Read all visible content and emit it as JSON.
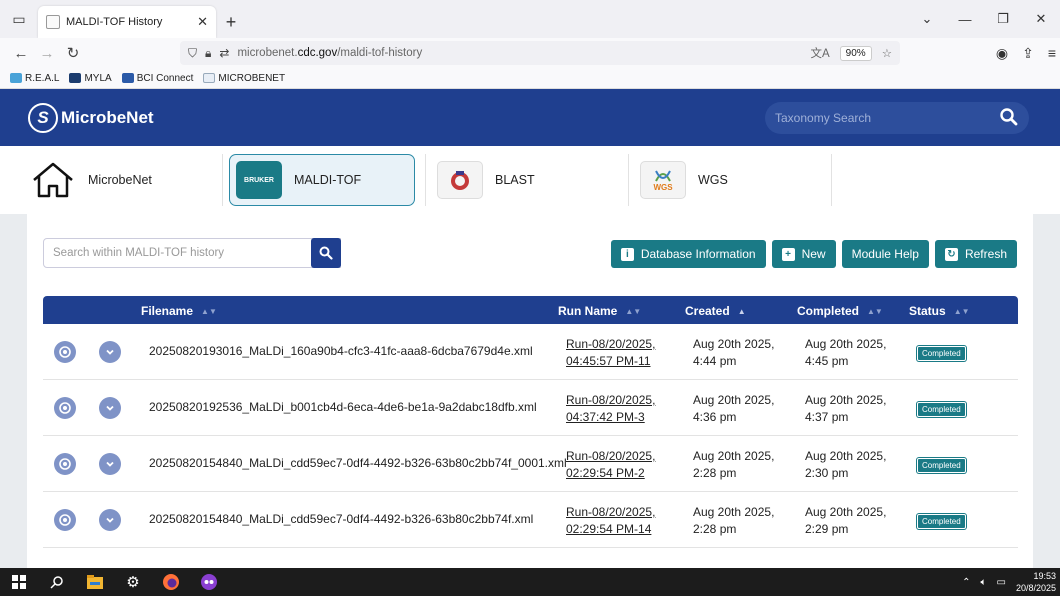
{
  "browser": {
    "tab_title": "MALDI-TOF History",
    "url_prefix": "microbenet.",
    "url_host": "cdc.gov",
    "url_path": "/maldi-tof-history",
    "zoom": "90%",
    "bookmarks": [
      "R.E.A.L",
      "MYLA",
      "BCI Connect",
      "MICROBENET"
    ]
  },
  "header": {
    "logo_text": "MicrobeNet",
    "search_placeholder": "Taxonomy Search"
  },
  "modules": {
    "home": "MicrobeNet",
    "maldi": "MALDI-TOF",
    "maldi_icon_text": "BRUKER",
    "blast": "BLAST",
    "wgs": "WGS",
    "wgs_icon_text": "WGS"
  },
  "history": {
    "search_placeholder": "Search within MALDI-TOF history",
    "buttons": {
      "db_info": "Database Information",
      "new": "New",
      "help": "Module Help",
      "refresh": "Refresh"
    },
    "columns": {
      "filename": "Filename",
      "run_name": "Run Name",
      "created": "Created",
      "completed": "Completed",
      "status": "Status"
    },
    "rows": [
      {
        "filename": "20250820193016_MaLDi_160a90b4-cfc3-41fc-aaa8-6dcba7679d4e.xml",
        "run_line1": "Run-08/20/2025,",
        "run_line2": "04:45:57 PM-11",
        "created_line1": "Aug 20th 2025,",
        "created_line2": "4:44 pm",
        "completed_line1": "Aug 20th 2025,",
        "completed_line2": "4:45 pm",
        "status": "Completed"
      },
      {
        "filename": "20250820192536_MaLDi_b001cb4d-6eca-4de6-be1a-9a2dabc18dfb.xml",
        "run_line1": "Run-08/20/2025,",
        "run_line2": "04:37:42 PM-3",
        "created_line1": "Aug 20th 2025,",
        "created_line2": "4:36 pm",
        "completed_line1": "Aug 20th 2025,",
        "completed_line2": "4:37 pm",
        "status": "Completed"
      },
      {
        "filename": "20250820154840_MaLDi_cdd59ec7-0df4-4492-b326-63b80c2bb74f_0001.xml",
        "run_line1": "Run-08/20/2025,",
        "run_line2": "02:29:54 PM-2",
        "created_line1": "Aug 20th 2025,",
        "created_line2": "2:28 pm",
        "completed_line1": "Aug 20th 2025,",
        "completed_line2": "2:30 pm",
        "status": "Completed"
      },
      {
        "filename": "20250820154840_MaLDi_cdd59ec7-0df4-4492-b326-63b80c2bb74f.xml",
        "run_line1": "Run-08/20/2025,",
        "run_line2": "02:29:54 PM-14",
        "created_line1": "Aug 20th 2025,",
        "created_line2": "2:28 pm",
        "completed_line1": "Aug 20th 2025,",
        "completed_line2": "2:29 pm",
        "status": "Completed"
      }
    ]
  },
  "taskbar": {
    "time": "19:53",
    "date": "20/8/2025"
  },
  "icons": [
    "tab-list-icon",
    "close-icon",
    "plus-icon",
    "back-icon",
    "forward-icon",
    "reload-icon",
    "shield-icon",
    "lock-icon",
    "translate-icon",
    "star-icon",
    "search-icon",
    "home-icon",
    "eye-icon",
    "chevron-down-icon",
    "info-icon",
    "refresh-icon"
  ],
  "colors": {
    "header_blue": "#1f3f8f",
    "teal": "#1a7a86",
    "row_button": "#7f93c7"
  }
}
